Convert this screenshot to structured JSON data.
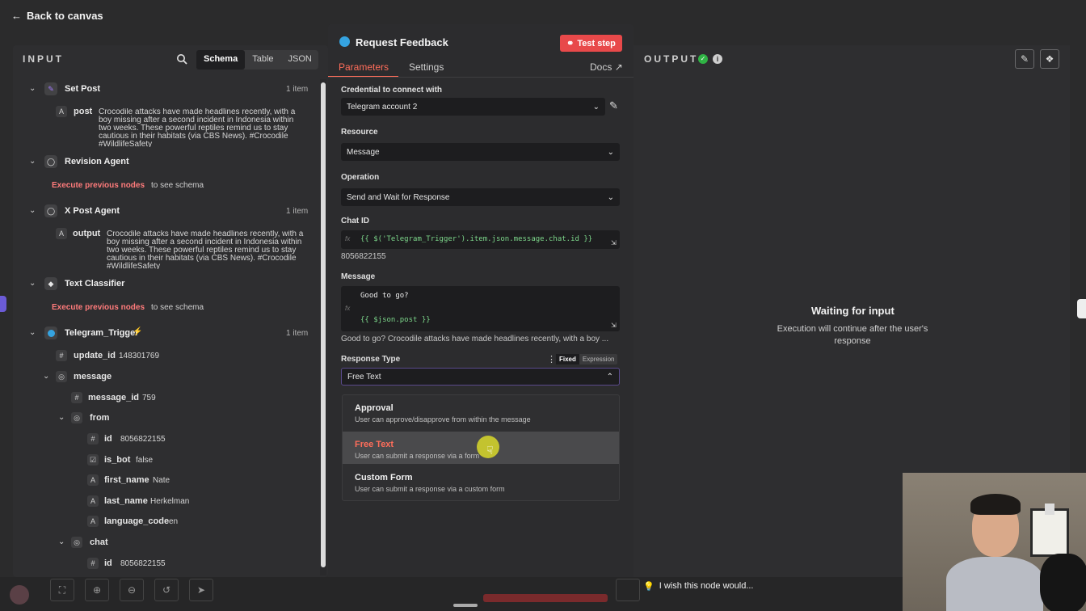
{
  "nav": {
    "back_label": "Back to canvas"
  },
  "input": {
    "title": "INPUT",
    "tabs": [
      "Schema",
      "Table",
      "JSON"
    ],
    "active_tab": "Schema",
    "nodes": {
      "set_post": {
        "name": "Set Post",
        "items": "1 item",
        "field": "post",
        "field_type": "A",
        "value": "Crocodile attacks have made headlines recently, with a boy missing after a second incident in Indonesia within two weeks. These powerful reptiles remind us to stay cautious in their habitats (via CBS News). #Crocodile #WildlifeSafety"
      },
      "revision_agent": {
        "name": "Revision Agent",
        "exec": "Execute previous nodes",
        "see": "to see schema"
      },
      "x_post_agent": {
        "name": "X Post Agent",
        "items": "1 item",
        "field": "output",
        "field_type": "A",
        "value": "Crocodile attacks have made headlines recently, with a boy missing after a second incident in Indonesia within two weeks. These powerful reptiles remind us to stay cautious in their habitats (via CBS News). #Crocodile #WildlifeSafety"
      },
      "text_classifier": {
        "name": "Text Classifier",
        "exec": "Execute previous nodes",
        "see": "to see schema"
      },
      "telegram_trigger": {
        "name": "Telegram_Trigger",
        "items": "1 item",
        "update_id": {
          "key": "update_id",
          "value": "148301769"
        },
        "message": "message",
        "message_id": {
          "key": "message_id",
          "value": "759"
        },
        "from": "from",
        "id": {
          "key": "id",
          "value": "8056822155"
        },
        "is_bot": {
          "key": "is_bot",
          "value": "false"
        },
        "first_name": {
          "key": "first_name",
          "value": "Nate"
        },
        "last_name": {
          "key": "last_name",
          "value": "Herkelman"
        },
        "language_code": {
          "key": "language_code",
          "value": "en"
        },
        "chat": "chat",
        "chat_id": {
          "key": "id",
          "value": "8056822155"
        }
      }
    }
  },
  "modal": {
    "title": "Request Feedback",
    "test_step": "Test step",
    "tabs": {
      "parameters": "Parameters",
      "settings": "Settings",
      "docs": "Docs"
    },
    "credential": {
      "label": "Credential to connect with",
      "value": "Telegram account 2"
    },
    "resource": {
      "label": "Resource",
      "value": "Message"
    },
    "operation": {
      "label": "Operation",
      "value": "Send and Wait for Response"
    },
    "chat_id": {
      "label": "Chat ID",
      "expr": "{{ $('Telegram_Trigger').item.json.message.chat.id }}",
      "result": "8056822155"
    },
    "message": {
      "label": "Message",
      "line1": "Good to go?",
      "line2": "{{ $json.post }}",
      "preview": "Good to go? Crocodile attacks have made headlines recently, with a boy ..."
    },
    "response_type": {
      "label": "Response Type",
      "fixed": "Fixed",
      "expression": "Expression",
      "value": "Free Text"
    },
    "options": [
      {
        "title": "Approval",
        "desc": "User can approve/disapprove from within the message"
      },
      {
        "title": "Free Text",
        "desc": "User can submit a response via a form"
      },
      {
        "title": "Custom Form",
        "desc": "User can submit a response via a custom form"
      }
    ],
    "hovered_option": "Free Text"
  },
  "output": {
    "title": "OUTPUT",
    "waiting": "Waiting for input",
    "waiting_sub": "Execution will continue after the user's response"
  },
  "footer": {
    "hint": "I wish this node would..."
  },
  "colors": {
    "accent": "#ff6d5a",
    "test_button": "#e8494a",
    "success": "#2fb344",
    "telegram": "#35a3e0"
  }
}
